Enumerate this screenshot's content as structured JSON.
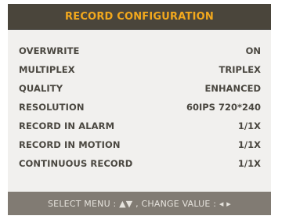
{
  "title": "RECORD CONFIGURATION",
  "settings": [
    {
      "label": "OVERWRITE",
      "value": "ON"
    },
    {
      "label": "MULTIPLEX",
      "value": "TRIPLEX"
    },
    {
      "label": "QUALITY",
      "value": "ENHANCED"
    },
    {
      "label": "RESOLUTION",
      "value": "60IPS 720*240"
    },
    {
      "label": "RECORD IN ALARM",
      "value": "1/1X"
    },
    {
      "label": "RECORD IN MOTION",
      "value": "1/1X"
    },
    {
      "label": "CONTINUOUS RECORD",
      "value": "1/1X"
    }
  ],
  "footer": {
    "hint": "SELECT MENU : ▲▼ , CHANGE VALUE : ◂ ▸"
  },
  "colors": {
    "title_bar_bg": "#4a453b",
    "title_text": "#f2a81d",
    "panel_bg": "#f1f0ee",
    "row_text": "#4a4740",
    "footer_bg": "#817b73",
    "footer_text": "#e6e3dd"
  }
}
